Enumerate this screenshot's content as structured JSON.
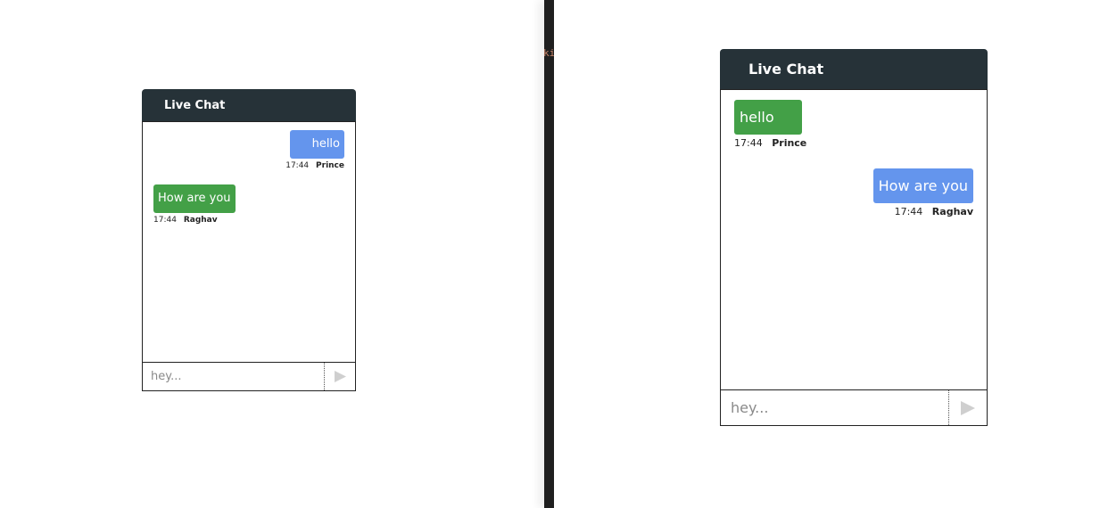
{
  "colors": {
    "header_bg": "#263238",
    "bubble_blue": "#6495ed",
    "bubble_green": "#43a047",
    "divider": "#1f1f1f",
    "send_icon": "#cfcfcf"
  },
  "divider_glyph": "ki",
  "left_chat": {
    "title": "Live Chat",
    "messages": [
      {
        "text": "hello",
        "time": "17:44",
        "sender": "Prince"
      },
      {
        "text": "How are you",
        "time": "17:44",
        "sender": "Raghav"
      }
    ],
    "input_placeholder": "hey...",
    "send_icon": "send-triangle-icon"
  },
  "right_chat": {
    "title": "Live Chat",
    "messages": [
      {
        "text": "hello",
        "time": "17:44",
        "sender": "Prince"
      },
      {
        "text": "How are you",
        "time": "17:44",
        "sender": "Raghav"
      }
    ],
    "input_placeholder": "hey...",
    "send_icon": "send-triangle-icon"
  }
}
